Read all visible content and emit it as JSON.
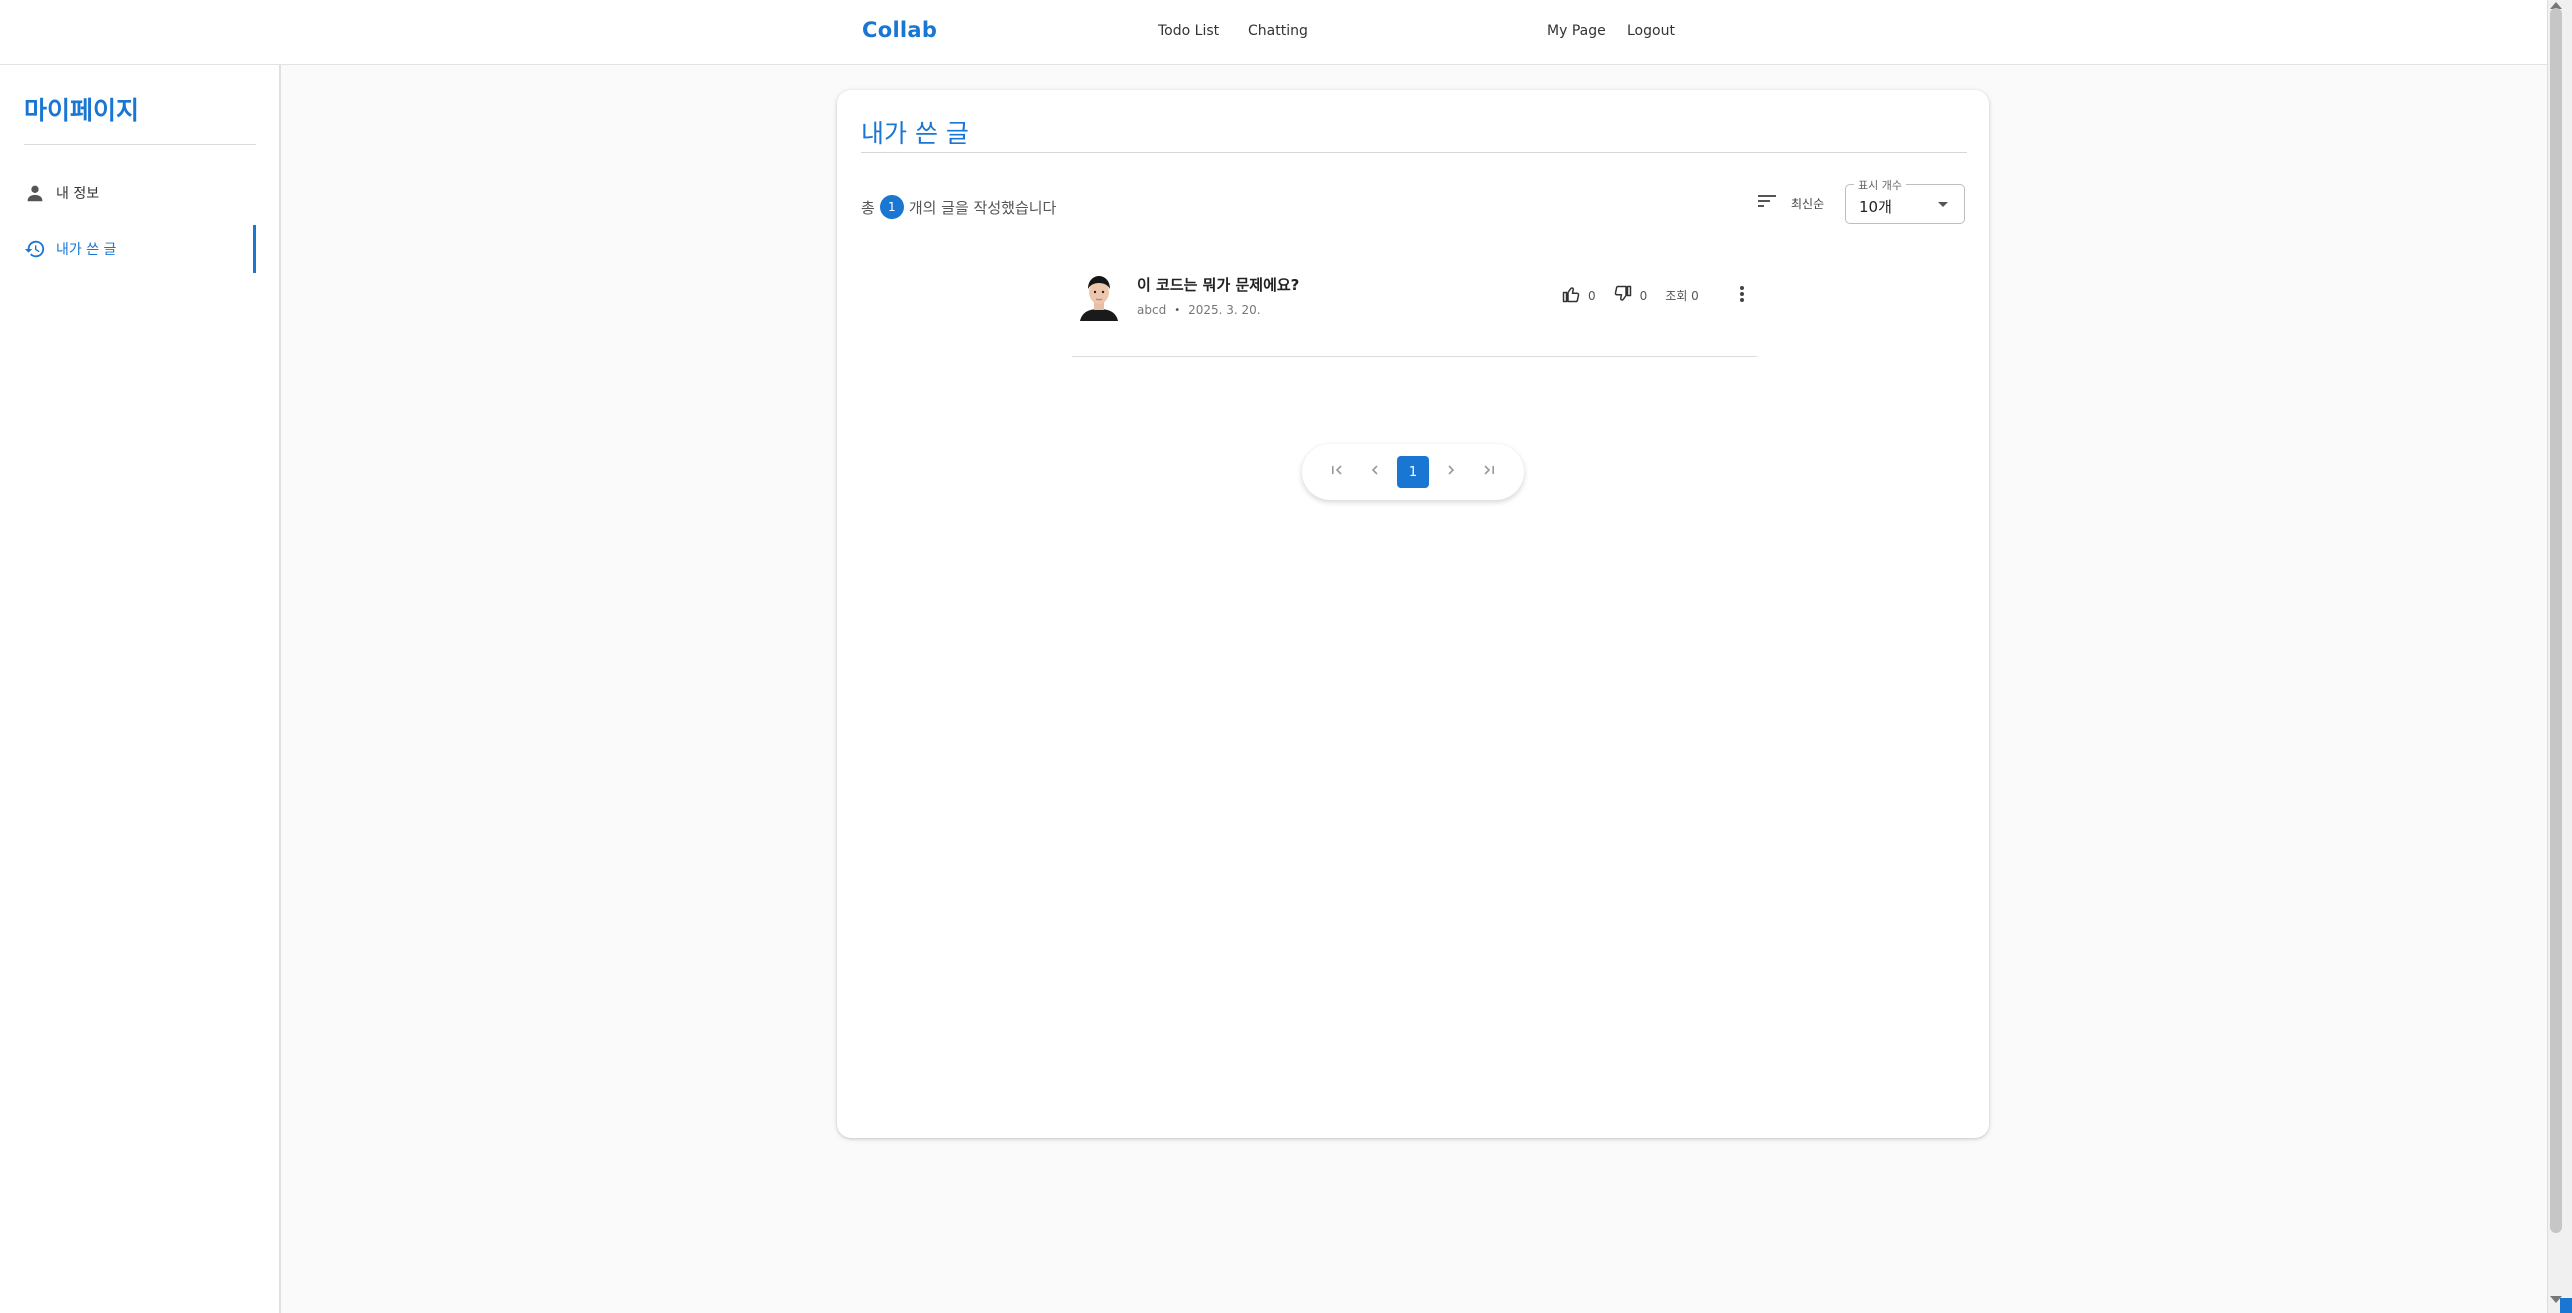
{
  "header": {
    "brand": "Collab",
    "nav": [
      "Todo List",
      "Chatting"
    ],
    "user_nav": [
      "My Page",
      "Logout"
    ]
  },
  "sidebar": {
    "title": "마이페이지",
    "items": [
      {
        "label": "내 정보",
        "icon": "person-icon",
        "active": false
      },
      {
        "label": "내가 쓴 글",
        "icon": "history-icon",
        "active": true
      }
    ]
  },
  "main": {
    "title": "내가 쓴 글",
    "count_prefix": "총",
    "count": "1",
    "count_suffix": "개의 글을 작성했습니다",
    "sort_label": "최신순",
    "page_size": {
      "legend": "표시 개수",
      "value": "10개"
    },
    "posts": [
      {
        "title": "이 코드는 뭐가 문제에요?",
        "author": "abcd",
        "date": "2025. 3. 20.",
        "likes": "0",
        "dislikes": "0",
        "views": "조회 0"
      }
    ],
    "pagination": {
      "current": "1"
    }
  },
  "colors": {
    "accent": "#1976d2",
    "background": "#fafafa",
    "card": "#ffffff"
  }
}
